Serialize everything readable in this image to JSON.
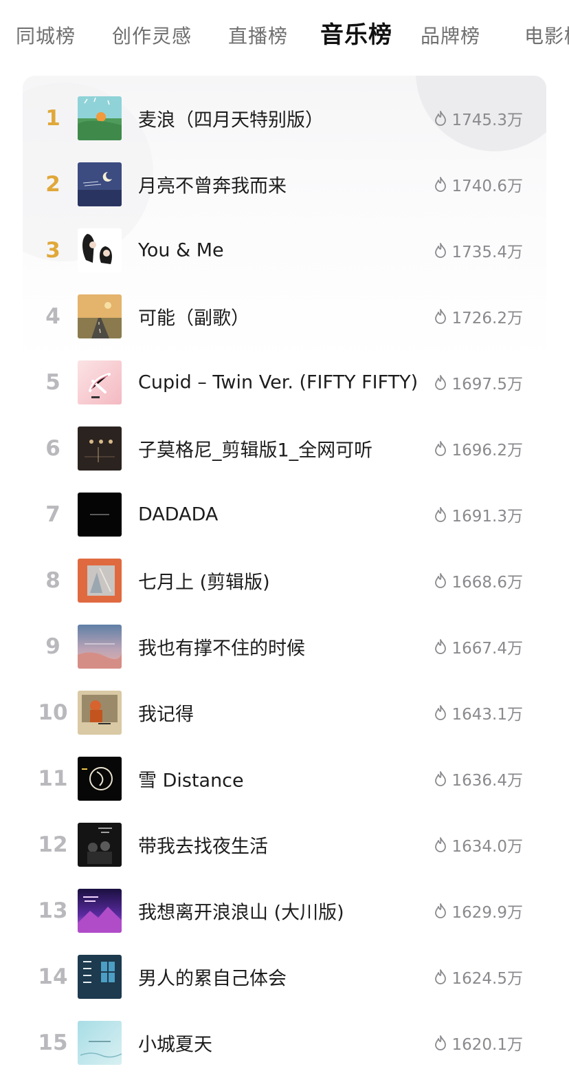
{
  "tabs": [
    {
      "label": "同城榜"
    },
    {
      "label": "创作灵感"
    },
    {
      "label": "直播榜"
    },
    {
      "label": "音乐榜"
    },
    {
      "label": "品牌榜"
    },
    {
      "label": "电影榜"
    }
  ],
  "songs": [
    {
      "rank": "1",
      "title": "麦浪（四月天特别版）",
      "heat": "1745.3万"
    },
    {
      "rank": "2",
      "title": "月亮不曾奔我而来",
      "heat": "1740.6万"
    },
    {
      "rank": "3",
      "title": "You & Me",
      "heat": "1735.4万"
    },
    {
      "rank": "4",
      "title": "可能（副歌）",
      "heat": "1726.2万"
    },
    {
      "rank": "5",
      "title": "Cupid – Twin Ver. (FIFTY FIFTY)",
      "heat": "1697.5万"
    },
    {
      "rank": "6",
      "title": "子莫格尼_剪辑版1_全网可听",
      "heat": "1696.2万"
    },
    {
      "rank": "7",
      "title": "DADADA",
      "heat": "1691.3万"
    },
    {
      "rank": "8",
      "title": "七月上 (剪辑版)",
      "heat": "1668.6万"
    },
    {
      "rank": "9",
      "title": "我也有撑不住的时候",
      "heat": "1667.4万"
    },
    {
      "rank": "10",
      "title": "我记得",
      "heat": "1643.1万"
    },
    {
      "rank": "11",
      "title": "雪 Distance",
      "heat": "1636.4万"
    },
    {
      "rank": "12",
      "title": "带我去找夜生活",
      "heat": "1634.0万"
    },
    {
      "rank": "13",
      "title": "我想离开浪浪山 (大川版)",
      "heat": "1629.9万"
    },
    {
      "rank": "14",
      "title": "男人的累自己体会",
      "heat": "1624.5万"
    },
    {
      "rank": "15",
      "title": "小城夏天",
      "heat": "1620.1万"
    }
  ],
  "colors": {
    "accent_rank": "#e0a83a",
    "rank_gray": "#b9b9bd",
    "heat_text": "#8a8a8e"
  },
  "icons": {
    "heat": "flame-icon"
  }
}
